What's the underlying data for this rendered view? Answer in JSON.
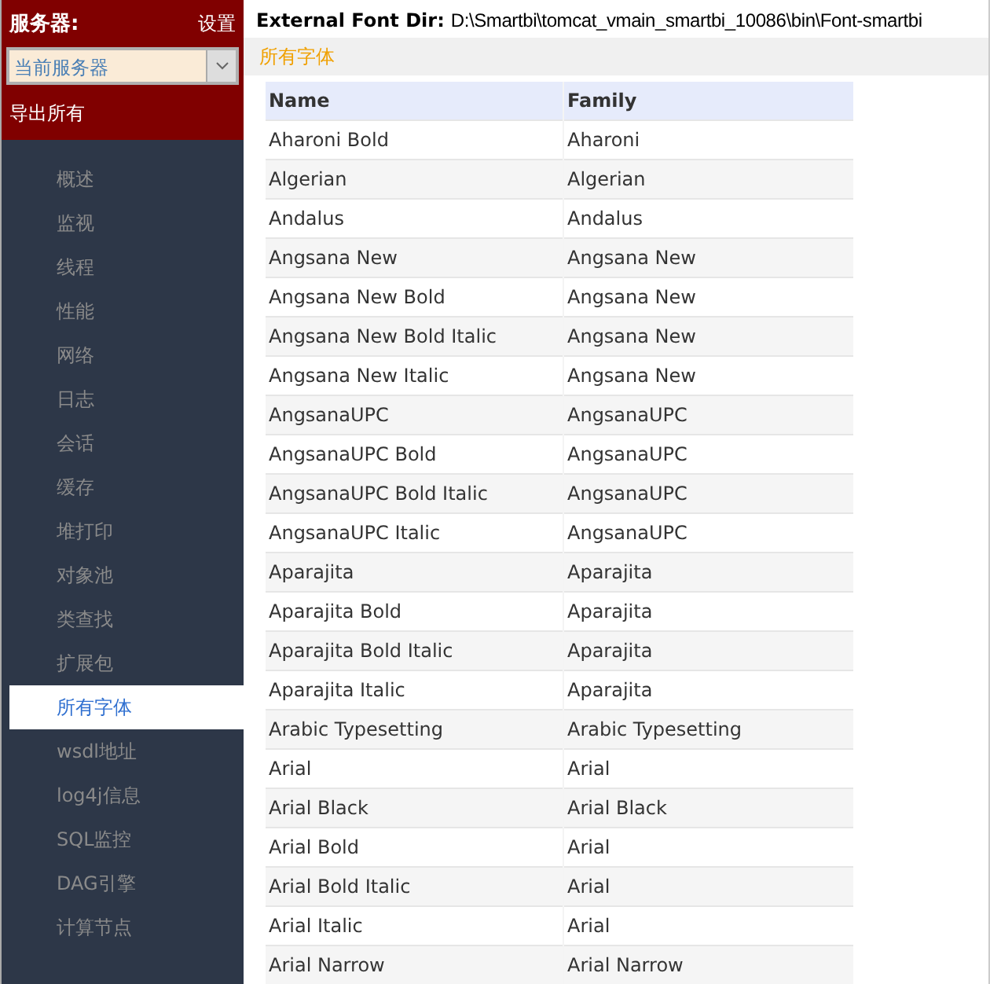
{
  "sidebar": {
    "server_label": "服务器:",
    "settings_link": "设置",
    "server_select": {
      "value": "当前服务器"
    },
    "export_link": "导出所有",
    "items": [
      {
        "label": "概述",
        "selected": false
      },
      {
        "label": "监视",
        "selected": false
      },
      {
        "label": "线程",
        "selected": false
      },
      {
        "label": "性能",
        "selected": false
      },
      {
        "label": "网络",
        "selected": false
      },
      {
        "label": "日志",
        "selected": false
      },
      {
        "label": "会话",
        "selected": false
      },
      {
        "label": "缓存",
        "selected": false
      },
      {
        "label": "堆打印",
        "selected": false
      },
      {
        "label": "对象池",
        "selected": false
      },
      {
        "label": "类查找",
        "selected": false
      },
      {
        "label": "扩展包",
        "selected": false
      },
      {
        "label": "所有字体",
        "selected": true
      },
      {
        "label": "wsdl地址",
        "selected": false
      },
      {
        "label": "log4j信息",
        "selected": false
      },
      {
        "label": "SQL监控",
        "selected": false
      },
      {
        "label": "DAG引擎",
        "selected": false
      },
      {
        "label": "计算节点",
        "selected": false
      }
    ]
  },
  "main": {
    "dir_label": "External Font Dir:",
    "dir_value": "D:\\Smartbi\\tomcat_vmain_smartbi_10086\\bin\\Font-smartbi",
    "section_title": "所有字体",
    "table": {
      "columns": [
        "Name",
        "Family"
      ],
      "rows": [
        [
          "Aharoni Bold",
          "Aharoni"
        ],
        [
          "Algerian",
          "Algerian"
        ],
        [
          "Andalus",
          "Andalus"
        ],
        [
          "Angsana New",
          "Angsana New"
        ],
        [
          "Angsana New Bold",
          "Angsana New"
        ],
        [
          "Angsana New Bold Italic",
          "Angsana New"
        ],
        [
          "Angsana New Italic",
          "Angsana New"
        ],
        [
          "AngsanaUPC",
          "AngsanaUPC"
        ],
        [
          "AngsanaUPC Bold",
          "AngsanaUPC"
        ],
        [
          "AngsanaUPC Bold Italic",
          "AngsanaUPC"
        ],
        [
          "AngsanaUPC Italic",
          "AngsanaUPC"
        ],
        [
          "Aparajita",
          "Aparajita"
        ],
        [
          "Aparajita Bold",
          "Aparajita"
        ],
        [
          "Aparajita Bold Italic",
          "Aparajita"
        ],
        [
          "Aparajita Italic",
          "Aparajita"
        ],
        [
          "Arabic Typesetting",
          "Arabic Typesetting"
        ],
        [
          "Arial",
          "Arial"
        ],
        [
          "Arial Black",
          "Arial Black"
        ],
        [
          "Arial Bold",
          "Arial"
        ],
        [
          "Arial Bold Italic",
          "Arial"
        ],
        [
          "Arial Italic",
          "Arial"
        ],
        [
          "Arial Narrow",
          "Arial Narrow"
        ]
      ]
    }
  }
}
